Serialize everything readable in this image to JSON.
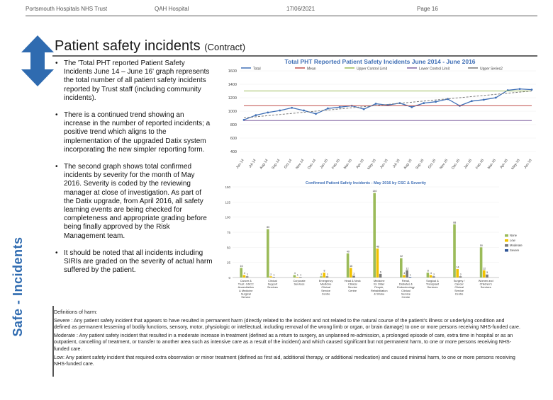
{
  "header": {
    "org": "Portsmouth Hospitals NHS Trust",
    "site": "QAH Hospital",
    "date": "17/06/2021",
    "page": "Page 16"
  },
  "side_label": "Safe - Incidents",
  "title": {
    "main": "Patient safety incidents",
    "sub": "(Contract)"
  },
  "bullets": [
    "The 'Total PHT reported Patient Safety Incidents June 14 – June 16' graph represents the total number of all patient safety incidents reported by Trust staff (including community incidents).",
    "There is a continued trend showing an increase in the number of reported incidents; a positive trend which aligns to the implementation of the upgraded Datix system incorporating the new simpler reporting form.",
    "The second graph shows total confirmed incidents by severity for the month of May 2016. Severity is coded by the reviewing manager at close of investigation. As part of the Datix upgrade, from April 2016, all safety learning events are being checked for completeness and appropriate grading before being finally approved by the Risk Management team.",
    "It should be noted that all incidents including SIRIs are graded on the severity of actual harm suffered by the patient."
  ],
  "definitions": [
    "Definitions of harm:",
    "Severe : Any patient safety incident that appears to have resulted in permanent harm (directly related to the incident and not related to the natural course of the patient's illness or underlying condition and defined as permanent lessening of bodily functions, sensory, motor, physiologic or intellectual, including removal of the wrong limb or organ, or brain damage) to one or more persons receiving NHS-funded care.",
    "Moderate : Any patient safety incident that resulted in a moderate increase in treatment (defined as a return to surgery, an unplanned re-admission, a prolonged episode of care, extra time in hospital or as an outpatient, cancelling of treatment, or transfer to another area such as intensive care as a result of the incident) and which caused significant but not permanent harm, to one or more persons receiving NHS-funded care.",
    "Low: Any patient safety incident that required extra observation or minor treatment (defined as first aid, additional therapy, or additional medication) and caused minimal harm, to one or more persons receiving NHS-funded care."
  ],
  "chart_data": [
    {
      "type": "line",
      "title": "Total PHT Reported Patient Safety Incidents  June 2014 - June 2016",
      "legend": [
        "Total",
        "Mean",
        "Upper Control Limit",
        "Lower Control Limit",
        "Upper Series2"
      ],
      "legend_position": "top",
      "colors": {
        "total": "#3f6fb6",
        "mean": "#c0504d",
        "ucl": "#9bbb59",
        "lcl": "#8064a2",
        "trend": "#7a7a7a"
      },
      "ylim": [
        400,
        1600
      ],
      "yticks": [
        400,
        600,
        800,
        1000,
        1200,
        1400,
        1600
      ],
      "x": [
        "Jun-14",
        "Jul-14",
        "Aug-14",
        "Sep-14",
        "Oct-14",
        "Nov-14",
        "Dec-14",
        "Jan-15",
        "Feb-15",
        "Mar-15",
        "Apr-15",
        "May-15",
        "Jun-15",
        "Jul-15",
        "Aug-15",
        "Sep-15",
        "Oct-15",
        "Nov-15",
        "Dec-15",
        "Jan-16",
        "Feb-16",
        "Mar-16",
        "Apr-16",
        "May-16",
        "Jun-16"
      ],
      "xtick_labels": [
        "Jun-14",
        "Jul-14",
        "Aug-14",
        "Sep-14",
        "Oct-14",
        "Nov-14",
        "Dec-14",
        "Jan-15",
        "Feb-15",
        "Mar-15",
        "Apr-15",
        "May-15",
        "Jun-15",
        "Jul-15",
        "Aug-15",
        "Sep-15",
        "Oct-15",
        "Nov-15",
        "Dec-15",
        "Jan-16",
        "Feb-16",
        "Mar-16",
        "Apr-16",
        "May-16",
        "Jun-16"
      ],
      "series": [
        {
          "key": "total",
          "values": [
            870,
            940,
            980,
            1010,
            1050,
            1010,
            960,
            1040,
            1060,
            1080,
            1030,
            1110,
            1090,
            1120,
            1060,
            1120,
            1140,
            1180,
            1080,
            1150,
            1170,
            1200,
            1310,
            1330,
            1320
          ]
        },
        {
          "key": "mean",
          "values": [
            1080,
            1080,
            1080,
            1080,
            1080,
            1080,
            1080,
            1080,
            1080,
            1080,
            1080,
            1080,
            1080,
            1080,
            1080,
            1080,
            1080,
            1080,
            1080,
            1080,
            1080,
            1080,
            1080,
            1080,
            1080
          ]
        },
        {
          "key": "ucl",
          "values": [
            1300,
            1300,
            1300,
            1300,
            1300,
            1300,
            1300,
            1300,
            1300,
            1300,
            1300,
            1300,
            1300,
            1300,
            1300,
            1300,
            1300,
            1300,
            1300,
            1300,
            1300,
            1300,
            1300,
            1300,
            1300
          ]
        },
        {
          "key": "lcl",
          "values": [
            860,
            860,
            860,
            860,
            860,
            860,
            860,
            860,
            860,
            860,
            860,
            860,
            860,
            860,
            860,
            860,
            860,
            860,
            860,
            860,
            860,
            860,
            860,
            860,
            860
          ]
        },
        {
          "key": "trend",
          "values": [
            900,
            1300
          ]
        }
      ]
    },
    {
      "type": "bar",
      "title": "Confirmed Patient Safety Incidents - May 2016 by CSC & Severity",
      "legend": [
        "None",
        "Low",
        "Moderate",
        "Severe"
      ],
      "legend_position": "right",
      "colors": {
        "None": "#9bbb59",
        "Low": "#f2c200",
        "Moderate": "#7a7a7a",
        "Severe": "#2f5597"
      },
      "ylim": [
        0,
        150
      ],
      "yticks": [
        0,
        25,
        50,
        75,
        100,
        125,
        150
      ],
      "ytick_labels": [
        "0",
        "25",
        "50",
        "75",
        "100",
        "125",
        "150"
      ],
      "categories": [
        "Cancer & Trust. GSCC Anaesthetics & Medicine Surgical Service Centre",
        "Clinical Support Services",
        "Corporate Services",
        "Emergency Medicine Clinical Service Centre",
        "Head & Neck Clinical Service Centre",
        "Medicine for Older People, Rehabilitation & Stroke",
        "Renal, Diabetes & Endocrinology Clinical Service Centre",
        "Surgical & Transplant Services",
        "Surgery / Cancer Clinical Service Centre",
        "Women and Children's Services"
      ],
      "series": [
        {
          "name": "None",
          "values": [
            16,
            80,
            4,
            2,
            40,
            140,
            32,
            8,
            88,
            50
          ]
        },
        {
          "name": "Low",
          "values": [
            4,
            2,
            1,
            8,
            16,
            48,
            4,
            4,
            14,
            12
          ]
        },
        {
          "name": "Moderate",
          "values": [
            2,
            1,
            1,
            2,
            3,
            6,
            12,
            2,
            2,
            5
          ]
        },
        {
          "name": "Severe",
          "values": [
            0,
            0,
            0,
            0,
            0,
            0,
            1,
            0,
            0,
            0
          ]
        }
      ]
    }
  ]
}
